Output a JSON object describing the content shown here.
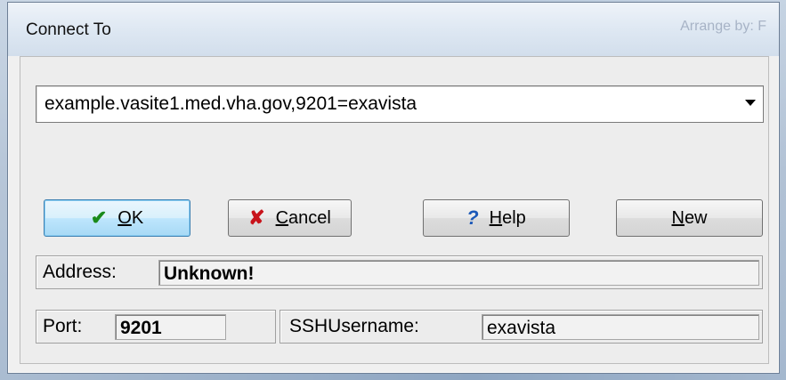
{
  "window": {
    "title": "Connect To",
    "background_hint": "Arrange by:  F"
  },
  "server_combo": {
    "selected": "example.vasite1.med.vha.gov,9201=exavista"
  },
  "buttons": {
    "ok": {
      "underline_char": "O",
      "rest": "K"
    },
    "cancel": {
      "underline_char": "C",
      "rest": "ancel"
    },
    "help": {
      "underline_char": "H",
      "rest": "elp"
    },
    "new": {
      "underline_char": "N",
      "rest": "ew"
    }
  },
  "address": {
    "label": "Address:",
    "value": "Unknown!"
  },
  "port": {
    "label": "Port:",
    "value": "9201"
  },
  "ssh": {
    "label": "SSHUsername:",
    "value": "exavista"
  },
  "colors": {
    "ok_icon": "#1a8a1a",
    "cancel_icon": "#c8131b",
    "help_icon": "#1b58b8",
    "default_button_border": "#3c7fb1"
  },
  "icons": {
    "ok": "checkmark-icon",
    "cancel": "x-icon",
    "help": "question-icon"
  }
}
